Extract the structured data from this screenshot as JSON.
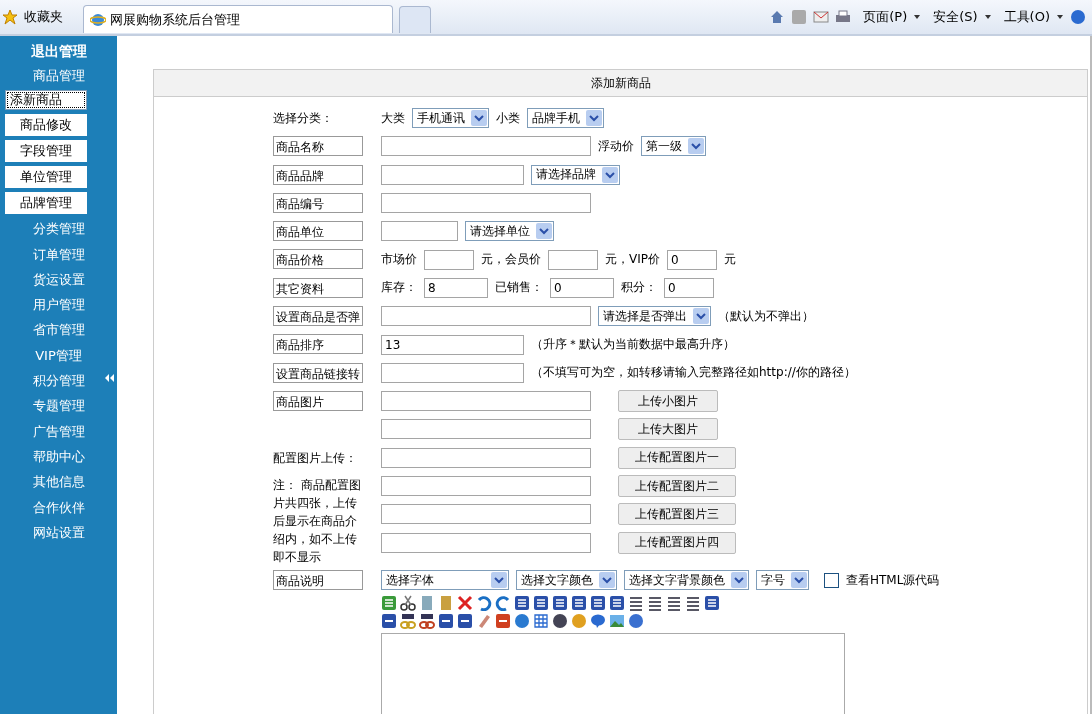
{
  "browser": {
    "favorites": "收藏夹",
    "tabs": [
      {
        "title": "网展购物系统后台管理",
        "selected": true
      }
    ],
    "menus": [
      "页面(P)",
      "安全(S)",
      "工具(O)"
    ]
  },
  "sidebar": {
    "header": "退出管理",
    "items": [
      {
        "label": "商品管理",
        "selected": false,
        "children": [
          {
            "label": "添新商品",
            "selected": true
          },
          {
            "label": "商品修改",
            "selected": false
          },
          {
            "label": "字段管理",
            "selected": false
          },
          {
            "label": "单位管理",
            "selected": false
          },
          {
            "label": "品牌管理",
            "selected": false
          }
        ]
      },
      {
        "label": "分类管理",
        "selected": false
      },
      {
        "label": "订单管理",
        "selected": false
      },
      {
        "label": "货运设置",
        "selected": false
      },
      {
        "label": "用户管理",
        "selected": false
      },
      {
        "label": "省市管理",
        "selected": false
      },
      {
        "label": "VIP管理",
        "selected": false
      },
      {
        "label": "积分管理",
        "selected": false
      },
      {
        "label": "专题管理",
        "selected": false
      },
      {
        "label": "广告管理",
        "selected": false
      },
      {
        "label": "帮助中心",
        "selected": false
      },
      {
        "label": "其他信息",
        "selected": false
      },
      {
        "label": "合作伙伴",
        "selected": false
      },
      {
        "label": "网站设置",
        "selected": false
      }
    ]
  },
  "form": {
    "title": "添加新商品",
    "rows": [
      {
        "label": {
          "kind": "plain",
          "text": "选择分类："
        },
        "lines": [
          [
            {
              "kind": "text",
              "text": "大类"
            },
            {
              "kind": "select",
              "value": "手机通讯"
            },
            {
              "kind": "text",
              "text": "小类"
            },
            {
              "kind": "select",
              "value": "品牌手机"
            }
          ]
        ]
      },
      {
        "label": {
          "kind": "boxed",
          "text": "商品名称"
        },
        "lines": [
          [
            {
              "kind": "input"
            },
            {
              "kind": "text",
              "text": "浮动价"
            },
            {
              "kind": "select",
              "value": "第一级"
            }
          ]
        ]
      },
      {
        "label": {
          "kind": "boxed",
          "text": "商品品牌"
        },
        "lines": [
          [
            {
              "kind": "midinput"
            },
            {
              "kind": "select",
              "value": "请选择品牌"
            }
          ]
        ]
      },
      {
        "label": {
          "kind": "boxed",
          "text": "商品编号"
        },
        "lines": [
          [
            {
              "kind": "input"
            }
          ]
        ]
      },
      {
        "label": {
          "kind": "boxed",
          "text": "商品单位"
        },
        "lines": [
          [
            {
              "kind": "shortinput"
            },
            {
              "kind": "select",
              "value": "请选择单位"
            }
          ]
        ]
      },
      {
        "label": {
          "kind": "boxed",
          "text": "商品价格"
        },
        "lines": [
          [
            {
              "kind": "text",
              "text": "市场价"
            },
            {
              "kind": "tinyinput"
            },
            {
              "kind": "text",
              "text": "元，会员价"
            },
            {
              "kind": "tinyinput"
            },
            {
              "kind": "text",
              "text": "元，VIP价"
            },
            {
              "kind": "tinyinput",
              "value": "0"
            },
            {
              "kind": "text",
              "text": "元"
            }
          ]
        ]
      },
      {
        "label": {
          "kind": "boxed",
          "text": "其它资料"
        },
        "lines": [
          [
            {
              "kind": "text",
              "text": "库存："
            },
            {
              "kind": "smallinput",
              "value": "8"
            },
            {
              "kind": "text",
              "text": "已销售："
            },
            {
              "kind": "smallinput",
              "value": "0"
            },
            {
              "kind": "text",
              "text": "积分："
            },
            {
              "kind": "tinyinput",
              "value": "0"
            }
          ]
        ]
      },
      {
        "label": {
          "kind": "boxed",
          "text": "设置商品是否弹"
        },
        "lines": [
          [
            {
              "kind": "input"
            },
            {
              "kind": "select",
              "value": "请选择是否弹出"
            },
            {
              "kind": "text",
              "text": "（默认为不弹出）"
            }
          ]
        ]
      },
      {
        "label": {
          "kind": "boxed",
          "text": "商品排序"
        },
        "lines": [
          [
            {
              "kind": "midinput",
              "value": "13"
            },
            {
              "kind": "text",
              "text": "（升序＊默认为当前数据中最高升序）"
            }
          ]
        ]
      },
      {
        "label": {
          "kind": "boxed",
          "text": "设置商品链接转"
        },
        "lines": [
          [
            {
              "kind": "midinput"
            },
            {
              "kind": "text",
              "text": "（不填写可为空，如转移请输入完整路径如http://你的路径）"
            }
          ]
        ]
      },
      {
        "label": {
          "kind": "boxed",
          "text": "商品图片"
        },
        "lines": [
          [
            {
              "kind": "input"
            },
            {
              "kind": "button",
              "text": "上传小图片"
            }
          ],
          [
            {
              "kind": "input"
            },
            {
              "kind": "button",
              "text": "上传大图片"
            }
          ]
        ]
      },
      {
        "label": {
          "kind": "plain",
          "text": "配置图片上传："
        },
        "lines": [
          [
            {
              "kind": "input"
            },
            {
              "kind": "button",
              "text": "上传配置图片一"
            }
          ]
        ]
      },
      {
        "label": {
          "kind": "note",
          "text": "注： 商品配置图片共四张，上传后显示在商品介绍内，如不上传即不显示"
        },
        "lines": [
          [
            {
              "kind": "input"
            },
            {
              "kind": "button",
              "text": "上传配置图片二"
            }
          ],
          [
            {
              "kind": "input"
            },
            {
              "kind": "button",
              "text": "上传配置图片三"
            }
          ],
          [
            {
              "kind": "input"
            },
            {
              "kind": "button",
              "text": "上传配置图片四"
            }
          ]
        ]
      },
      {
        "label": {
          "kind": "boxed",
          "text": "商品说明"
        },
        "lines": [
          [
            {
              "kind": "wideselect",
              "value": "选择字体"
            },
            {
              "kind": "select",
              "value": "选择文字颜色"
            },
            {
              "kind": "select",
              "value": "选择文字背景颜色"
            },
            {
              "kind": "select",
              "value": "字号"
            },
            {
              "kind": "checkbox",
              "text": "查看HTML源代码",
              "checked": false
            }
          ]
        ]
      }
    ]
  }
}
